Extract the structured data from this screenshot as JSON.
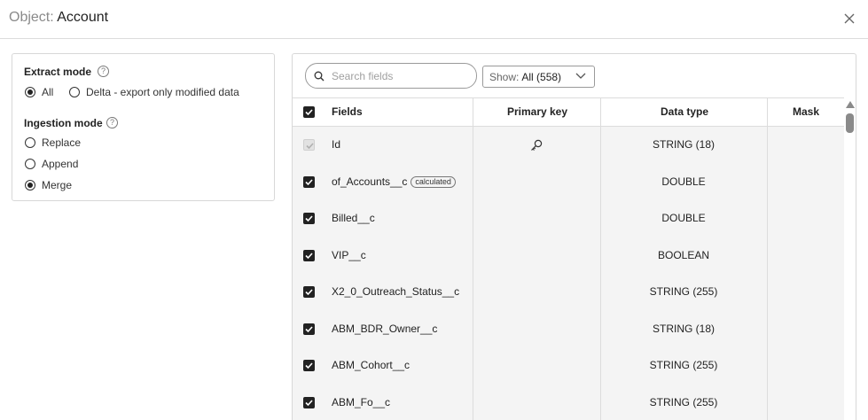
{
  "header": {
    "title_label": "Object:",
    "title_value": "Account"
  },
  "options": {
    "extract_mode": {
      "title": "Extract mode",
      "help": "?",
      "options": [
        {
          "label": "All",
          "selected": true
        },
        {
          "label": "Delta - export only modified data",
          "selected": false
        }
      ]
    },
    "ingestion_mode": {
      "title": "Ingestion mode",
      "help": "?",
      "options": [
        {
          "label": "Replace",
          "selected": false
        },
        {
          "label": "Append",
          "selected": false
        },
        {
          "label": "Merge",
          "selected": true
        }
      ]
    }
  },
  "fields": {
    "search_placeholder": "Search fields",
    "show_label": "Show:",
    "show_value": "All (558)",
    "columns": {
      "fields": "Fields",
      "primary_key": "Primary key",
      "data_type": "Data type",
      "mask": "Mask"
    },
    "rows": [
      {
        "name": "Id",
        "badge": "",
        "primary_key": true,
        "data_type": "STRING (18)",
        "checked": true,
        "disabled": true
      },
      {
        "name": "of_Accounts__c",
        "badge": "calculated",
        "primary_key": false,
        "data_type": "DOUBLE",
        "checked": true,
        "disabled": false
      },
      {
        "name": "Billed__c",
        "badge": "",
        "primary_key": false,
        "data_type": "DOUBLE",
        "checked": true,
        "disabled": false
      },
      {
        "name": "VIP__c",
        "badge": "",
        "primary_key": false,
        "data_type": "BOOLEAN",
        "checked": true,
        "disabled": false
      },
      {
        "name": "X2_0_Outreach_Status__c",
        "badge": "",
        "primary_key": false,
        "data_type": "STRING (255)",
        "checked": true,
        "disabled": false
      },
      {
        "name": "ABM_BDR_Owner__c",
        "badge": "",
        "primary_key": false,
        "data_type": "STRING (18)",
        "checked": true,
        "disabled": false
      },
      {
        "name": "ABM_Cohort__c",
        "badge": "",
        "primary_key": false,
        "data_type": "STRING (255)",
        "checked": true,
        "disabled": false
      },
      {
        "name": "ABM_Fo__c",
        "badge": "",
        "primary_key": false,
        "data_type": "STRING (255)",
        "checked": true,
        "disabled": false
      }
    ]
  }
}
